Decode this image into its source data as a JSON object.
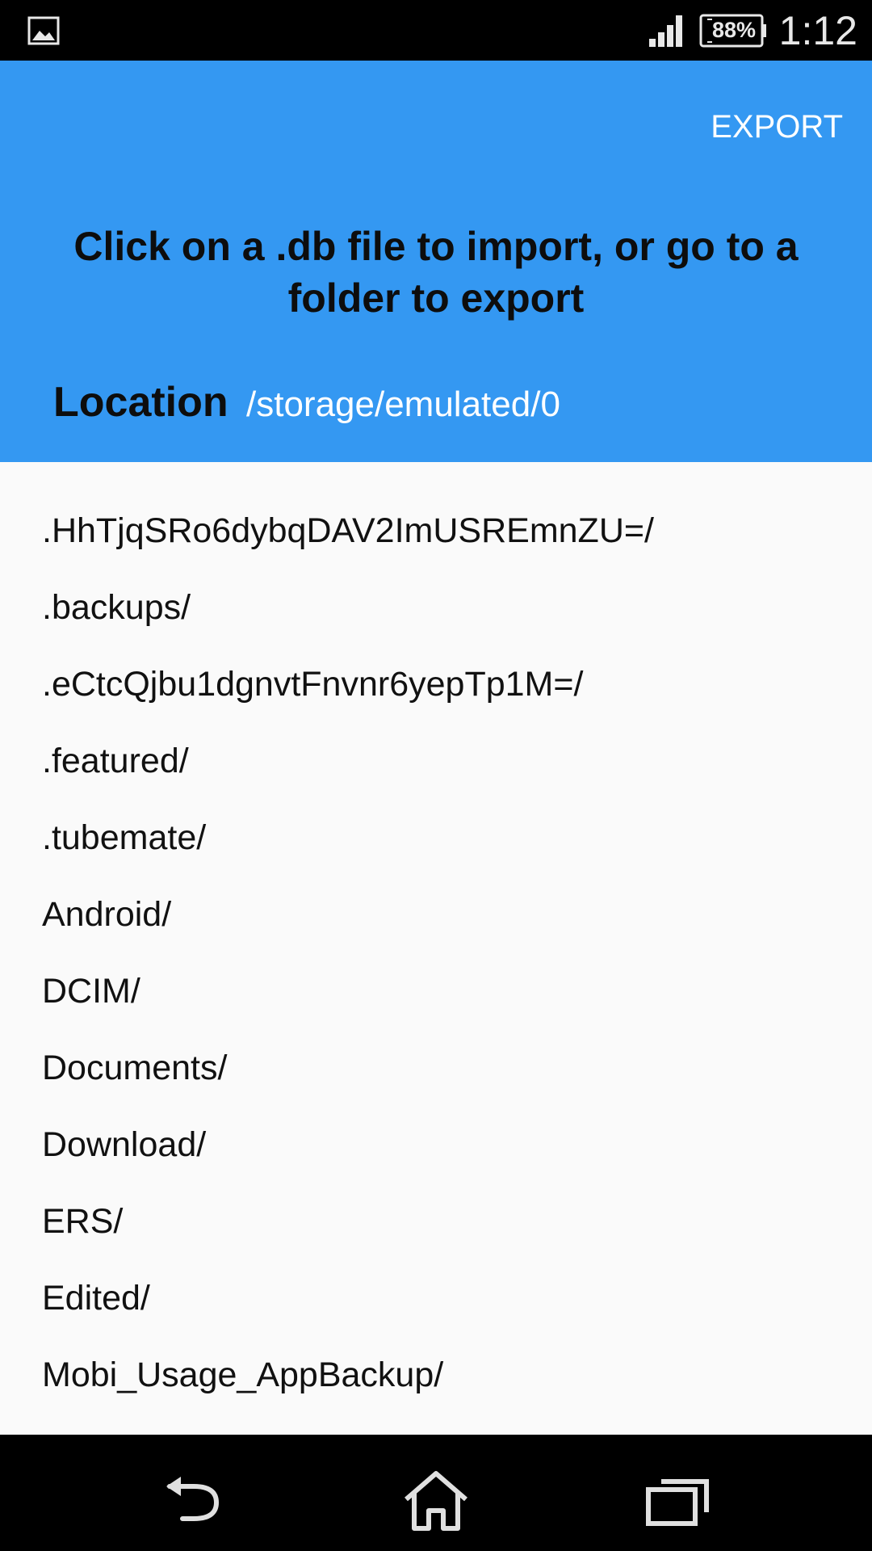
{
  "status_bar": {
    "battery": "88%",
    "time": "1:12",
    "icons": [
      "gallery-icon",
      "signal-icon",
      "battery-icon"
    ]
  },
  "header": {
    "export_label": "EXPORT",
    "instruction": "Click on a .db file to import, or go to a folder to export",
    "location_label": "Location",
    "location_path": "/storage/emulated/0",
    "background_color": "#3498f2"
  },
  "files": [
    ".HhTjqSRo6dybqDAV2ImUSREmnZU=/",
    ".backups/",
    ".eCtcQjbu1dgnvtFnvnr6yepTp1M=/",
    ".featured/",
    ".tubemate/",
    "Android/",
    "DCIM/",
    "Documents/",
    "Download/",
    "ERS/",
    "Edited/",
    "Mobi_Usage_AppBackup/"
  ],
  "nav_bar": {
    "icons": [
      "back-icon",
      "home-icon",
      "recent-apps-icon"
    ]
  }
}
